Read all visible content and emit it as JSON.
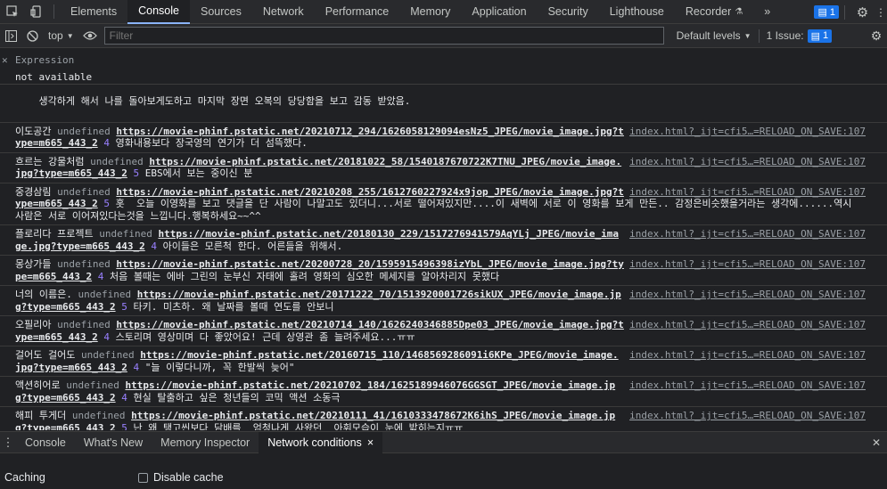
{
  "topbar": {
    "tabs": [
      "Elements",
      "Console",
      "Sources",
      "Network",
      "Performance",
      "Memory",
      "Application",
      "Security",
      "Lighthouse",
      "Recorder"
    ],
    "active_tab": "Console",
    "more": "»",
    "messages_count": "1"
  },
  "toolbar": {
    "context": "top",
    "filter_placeholder": "Filter",
    "levels": "Default levels",
    "issues_label": "1 Issue:",
    "issues_count": "1"
  },
  "expression": {
    "label": "Expression",
    "value": "not available"
  },
  "console": {
    "partial_line": "생각하게 해서 나를 돌아보게도하고 마지막 장면 오복의 당당함을 보고 감동 받았음.",
    "messages": [
      {
        "title": "이도공간",
        "undef": "undefined",
        "url": "https://movie-phinf.pstatic.net/20210712_294/1626058129094esNz5_JPEG/movie_image.jpg?type=m665_443_2",
        "num": "4",
        "text": "영화내용보다 장국영의 연기가 더 섬뜩했다.",
        "source": "index.html?_ijt=cfi5…=RELOAD_ON_SAVE:107"
      },
      {
        "title": "흐르는 강물처럼",
        "undef": "undefined",
        "url": "https://movie-phinf.pstatic.net/20181022_58/1540187670722K7TNU_JPEG/movie_image.jpg?type=m665_443_2",
        "num": "5",
        "text": "EBS에서 보는 중이신 분",
        "source": "index.html?_ijt=cfi5…=RELOAD_ON_SAVE:107"
      },
      {
        "title": "중경삼림",
        "undef": "undefined",
        "url": "https://movie-phinf.pstatic.net/20210208_255/1612760227924x9jop_JPEG/movie_image.jpg?type=m665_443_2",
        "num": "5",
        "text": "홋  오늘 이영화를 보고 댓글을 단 사람이 나말고도 있더니...서로 떨어져있지만....이 새벽에 서로 이 영화를 보게 만든.. 감정은비슷했을거라는 생각에......역시 사람은 서로 이어져있다는것을 느낍니다.행복하세요~~^^",
        "source": "index.html?_ijt=cfi5…=RELOAD_ON_SAVE:107"
      },
      {
        "title": "플로리다 프로젝트",
        "undef": "undefined",
        "url": "https://movie-phinf.pstatic.net/20180130_229/1517276941579AqYLj_JPEG/movie_image.jpg?type=m665_443_2",
        "num": "4",
        "text": "아이들은 모른척 한다. 어른들을 위해서.",
        "source": "index.html?_ijt=cfi5…=RELOAD_ON_SAVE:107"
      },
      {
        "title": "몽상가들",
        "undef": "undefined",
        "url": "https://movie-phinf.pstatic.net/20200728_20/1595915496398izYbL_JPEG/movie_image.jpg?type=m665_443_2",
        "num": "4",
        "text": "처음 볼때는 에바 그린의 눈부신 자태에 홀려 영화의 심오한 메세지를 알아차리지 못했다",
        "source": "index.html?_ijt=cfi5…=RELOAD_ON_SAVE:107"
      },
      {
        "title": "너의 이름은.",
        "undef": "undefined",
        "url": "https://movie-phinf.pstatic.net/20171222_70/1513920001726sikUX_JPEG/movie_image.jpg?type=m665_443_2",
        "num": "5",
        "text": "타키. 미츠하. 왜 날짜를 볼때 연도를 안보니",
        "source": "index.html?_ijt=cfi5…=RELOAD_ON_SAVE:107"
      },
      {
        "title": "오필리아",
        "undef": "undefined",
        "url": "https://movie-phinf.pstatic.net/20210714_140/1626240346885Dpe03_JPEG/movie_image.jpg?type=m665_443_2",
        "num": "4",
        "text": "스토리며 영상미며 다 좋았어요! 근데 상영관 좀 늘려주세요...ㅠㅠ",
        "source": "index.html?_ijt=cfi5…=RELOAD_ON_SAVE:107"
      },
      {
        "title": "걸어도 걸어도",
        "undef": "undefined",
        "url": "https://movie-phinf.pstatic.net/20160715_110/1468569286091i6KPe_JPEG/movie_image.jpg?type=m665_443_2",
        "num": "4",
        "text": "\"늘 이렇다니까, 꼭 한발씩 늦어\"",
        "source": "index.html?_ijt=cfi5…=RELOAD_ON_SAVE:107"
      },
      {
        "title": "액션히어로",
        "undef": "undefined",
        "url": "https://movie-phinf.pstatic.net/20210702_184/1625189946076GGSGT_JPEG/movie_image.jpg?type=m665_443_2",
        "num": "4",
        "text": "현실 탈출하고 싶은 청년들의 코믹 액션 소동극",
        "source": "index.html?_ijt=cfi5…=RELOAD_ON_SAVE:107"
      },
      {
        "title": "해피 투게더",
        "undef": "undefined",
        "url": "https://movie-phinf.pstatic.net/20210111_41/1610333478672K6ihS_JPEG/movie_image.jpg?type=m665_443_2",
        "num": "5",
        "text": "난 왜 탱고씬보다 담배를  엄청나게 사왔던  아휘모습이 눈에 밟히는지ㅠㅠ",
        "source": "index.html?_ijt=cfi5…=RELOAD_ON_SAVE:107"
      }
    ]
  },
  "drawer": {
    "tabs": [
      "Console",
      "What's New",
      "Memory Inspector",
      "Network conditions"
    ],
    "active_tab": "Network conditions",
    "close": "×",
    "caching_label": "Caching",
    "disable_cache_label": "Disable cache"
  },
  "colors": {
    "background": "#202124",
    "toolbar": "#292a2d",
    "accent": "#1a73e8",
    "number": "#9980ff"
  }
}
